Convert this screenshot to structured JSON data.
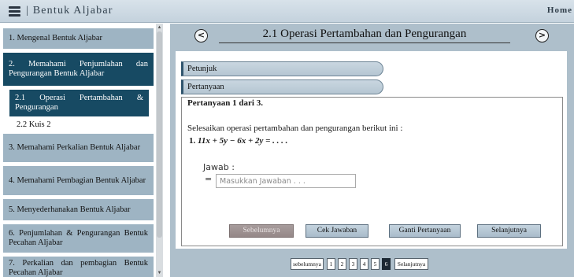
{
  "header": {
    "menu_icon": "hamburger-menu-icon",
    "title": "| Bentuk Aljabar",
    "home_label": "Home"
  },
  "sidebar": {
    "items": [
      {
        "label": "1. Mengenal Bentuk Aljabar"
      },
      {
        "label": "2. Memahami Penjumlahan dan Pengurangan Bentuk Aljabar"
      },
      {
        "label": "2.1 Operasi Pertambahan & Pengurangan"
      },
      {
        "label": "2.2 Kuis 2"
      },
      {
        "label": "3. Memahami Perkalian Bentuk Aljabar"
      },
      {
        "label": "4. Memahami Pembagian Bentuk Aljabar"
      },
      {
        "label": "5. Menyederhanakan Bentuk Aljabar"
      },
      {
        "label": "6. Penjumlahan & Pengurangan Bentuk Pecahan Aljabar"
      },
      {
        "label": "7. Perkalian dan pembagian Bentuk Pecahan Aljabar"
      }
    ]
  },
  "main": {
    "prev_icon": "chevron-left-circle-icon",
    "next_icon": "chevron-right-circle-icon",
    "prev_glyph": "<",
    "next_glyph": ">",
    "section_title": "2.1 Operasi Pertambahan dan Pengurangan",
    "tabs": {
      "petunjuk": "Petunjuk",
      "pertanyaan": "Pertanyaan"
    },
    "question": {
      "heading": "Pertanyaan 1 dari 3.",
      "instruction": "Selesaikan operasi pertambahan dan pengurangan berikut ini :",
      "number": "1.",
      "expression": "11x + 5y − 6x + 2y = . . . .",
      "answer_label": "Jawab :",
      "equals": "=",
      "answer_placeholder": "Masukkan Jawaban . . .",
      "answer_value": ""
    },
    "actions": {
      "previous": "Sebelumnya",
      "check": "Cek Jawaban",
      "change": "Ganti Pertanyaan",
      "next": "Selanjutnya"
    },
    "pager": {
      "prev_label": "sebelumnya",
      "pages": [
        "1",
        "2",
        "3",
        "4",
        "5",
        "6"
      ],
      "current_page": "6",
      "next_label": "Selanjutnya"
    }
  }
}
